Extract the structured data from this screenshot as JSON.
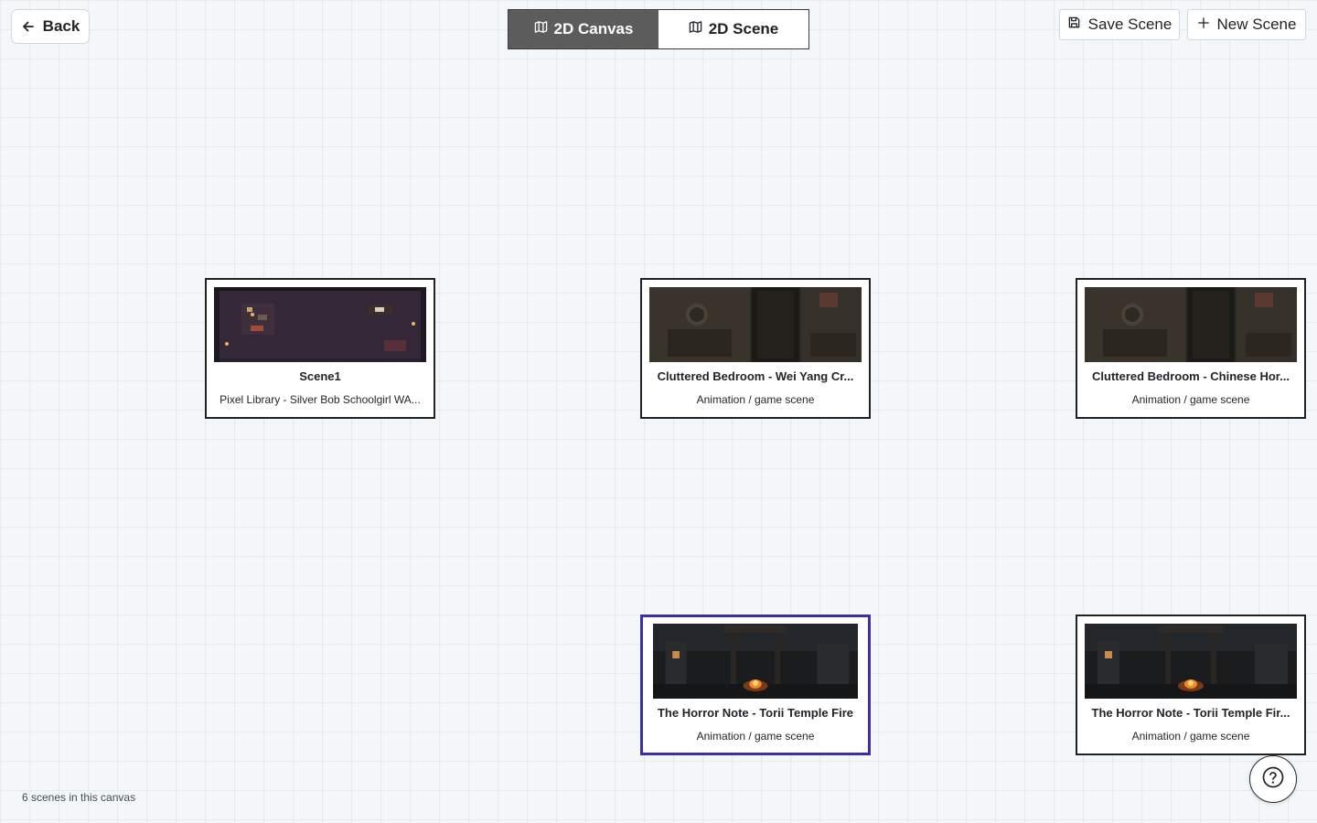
{
  "header": {
    "back_label": "Back",
    "modes": [
      {
        "label": "2D Canvas",
        "active": true,
        "icon": "map-icon"
      },
      {
        "label": "2D Scene",
        "active": false,
        "icon": "map-icon"
      }
    ],
    "save_label": "Save Scene",
    "new_label": "New Scene"
  },
  "scenes": [
    {
      "title": "Scene1",
      "subtitle": "Pixel Library - Silver Bob Schoolgirl WA...",
      "selected": false,
      "thumb": "library"
    },
    {
      "title": "Cluttered Bedroom - Wei Yang Cr...",
      "subtitle": "Animation / game scene",
      "selected": false,
      "thumb": "bedroom"
    },
    {
      "title": "Cluttered Bedroom - Chinese Hor...",
      "subtitle": "Animation / game scene",
      "selected": false,
      "thumb": "bedroom"
    },
    {
      "title": "The Horror Note - Torii Temple Fire",
      "subtitle": "Animation / game scene",
      "selected": true,
      "thumb": "temple"
    },
    {
      "title": "The Horror Note - Torii Temple Fir...",
      "subtitle": "Animation / game scene",
      "selected": false,
      "thumb": "temple"
    }
  ],
  "footer": {
    "count_text": "6 scenes in this canvas"
  },
  "colors": {
    "active_toggle": "#5c5c5c",
    "selected_border": "#3a2fa8",
    "canvas_bg": "#f4f7fa"
  }
}
